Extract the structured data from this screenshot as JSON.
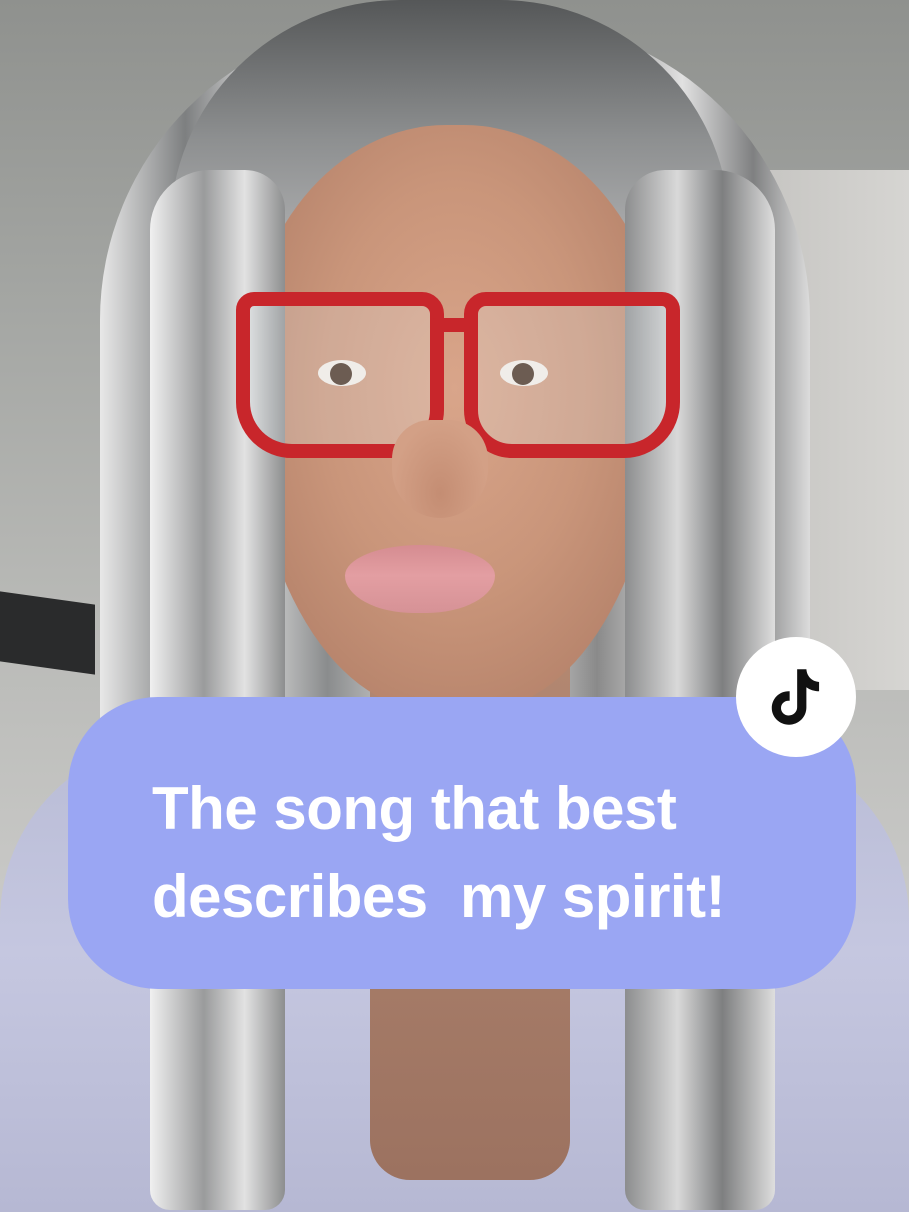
{
  "caption": {
    "line1": "The song that best",
    "line2": "describes  my spirit!"
  },
  "logo": {
    "icon": "tiktok-logo-icon"
  },
  "colors": {
    "bubble": "#9aa6f3",
    "caption_text": "#ffffff",
    "logo_badge": "#ffffff",
    "logo_glyph": "#111111",
    "glasses": "#c8262b"
  }
}
